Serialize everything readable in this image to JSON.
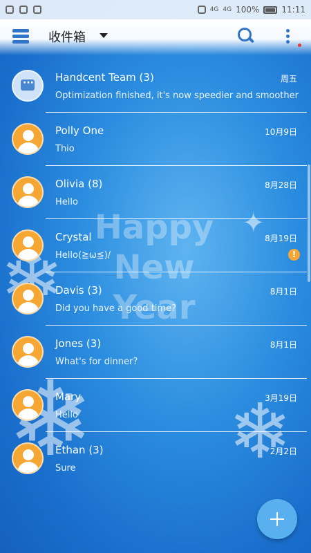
{
  "statusbar": {
    "battery": "100%",
    "time": "11:11",
    "net1": "4G",
    "net2": "4G"
  },
  "toolbar": {
    "title": "收件箱",
    "icons": [
      "menu-icon",
      "search-icon",
      "more-vert-icon"
    ]
  },
  "background": {
    "watermark_line1": "Happy",
    "watermark_line2": "New",
    "watermark_line3": "Year"
  },
  "conversations": [
    {
      "name": "Handcent Team (3)",
      "snippet": "Optimization finished, it's now speedier and smoother",
      "date": "周五",
      "avatar": "team"
    },
    {
      "name": "Polly One",
      "snippet": "Thio",
      "date": "10月9日",
      "avatar": "person"
    },
    {
      "name": "Olivia (8)",
      "snippet": "Hello",
      "date": "8月28日",
      "avatar": "person"
    },
    {
      "name": "Crystal",
      "snippet": "Hello(≧ω≦)/",
      "date": "8月19日",
      "avatar": "person",
      "warning": "!"
    },
    {
      "name": "Davis (3)",
      "snippet": "Did you have a good time?",
      "date": "8月1日",
      "avatar": "person"
    },
    {
      "name": "Jones (3)",
      "snippet": "What's for dinner?",
      "date": "8月1日",
      "avatar": "person"
    },
    {
      "name": "Mary",
      "snippet": "Hello",
      "date": "3月19日",
      "avatar": "person"
    },
    {
      "name": "Ethan (3)",
      "snippet": "Sure",
      "date": "2月2日",
      "avatar": "person"
    }
  ],
  "colors": {
    "accent": "#2f74c9",
    "avatar": "#f6a733",
    "fab": "#5ab0ee"
  }
}
